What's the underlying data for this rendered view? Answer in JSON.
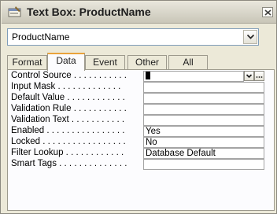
{
  "window": {
    "title": "Text Box: ProductName"
  },
  "selector": {
    "value": "ProductName"
  },
  "tabs": [
    {
      "label": "Format",
      "active": false
    },
    {
      "label": "Data",
      "active": true
    },
    {
      "label": "Event",
      "active": false
    },
    {
      "label": "Other",
      "active": false
    },
    {
      "label": "All",
      "active": false
    }
  ],
  "properties": [
    {
      "label": "Control Source . . . . . . . . . . .",
      "value": ""
    },
    {
      "label": "Input Mask . . . . . . . . . . . . .",
      "value": ""
    },
    {
      "label": "Default Value . . . . . . . . . . . .",
      "value": ""
    },
    {
      "label": "Validation Rule . . . . . . . . . . .",
      "value": ""
    },
    {
      "label": "Validation Text . . . . . . . . . . .",
      "value": ""
    },
    {
      "label": "Enabled . . . . . . . . . . . . . . . .",
      "value": "Yes"
    },
    {
      "label": "Locked . . . . . . . . . . . . . . . . .",
      "value": "No"
    },
    {
      "label": "Filter Lookup . . . . . . . . . . . .",
      "value": "Database Default"
    },
    {
      "label": "Smart Tags . . . . . . . . . . . . . .",
      "value": ""
    }
  ],
  "icons": {
    "title": "properties-window-icon",
    "close": "close-icon",
    "combo": "chevron-down-icon",
    "build": "ellipsis-icon"
  }
}
